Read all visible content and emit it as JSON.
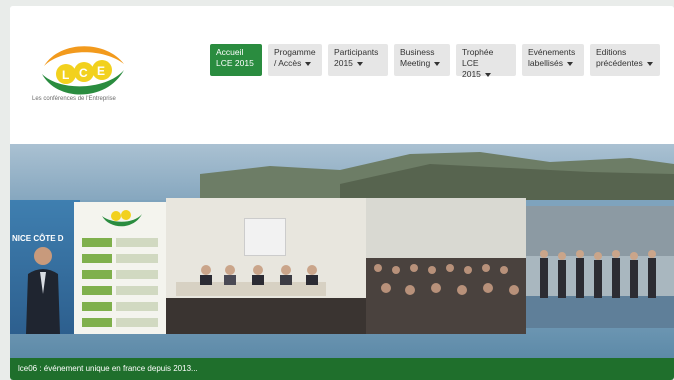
{
  "brand": {
    "logo_letters": [
      "L",
      "C",
      "E"
    ],
    "tagline": "Les conférences de l'Entreprise",
    "colors": {
      "green": "#2a8c3f",
      "orange": "#f29a1d",
      "yellow": "#f2d11e",
      "dark_green": "#1f6f2c"
    }
  },
  "nav": {
    "items": [
      {
        "label_line1": "Accueil",
        "label_line2": "LCE 2015",
        "active": true,
        "has_caret": false
      },
      {
        "label_line1": "Progamme",
        "label_line2": "/ Accès",
        "active": false,
        "has_caret": true
      },
      {
        "label_line1": "Participants",
        "label_line2": "2015",
        "active": false,
        "has_caret": true
      },
      {
        "label_line1": "Business",
        "label_line2": "Meeting",
        "active": false,
        "has_caret": true
      },
      {
        "label_line1": "Trophée LCE",
        "label_line2": "2015",
        "active": false,
        "has_caret": true
      },
      {
        "label_line1": "Evénements",
        "label_line2": "labellisés",
        "active": false,
        "has_caret": true
      },
      {
        "label_line1": "Editions",
        "label_line2": "précédentes",
        "active": false,
        "has_caret": true
      }
    ]
  },
  "hero": {
    "banner_text": "NICE CÔTE D"
  },
  "footer": {
    "text": "lce06 : événement unique en france depuis 2013..."
  }
}
